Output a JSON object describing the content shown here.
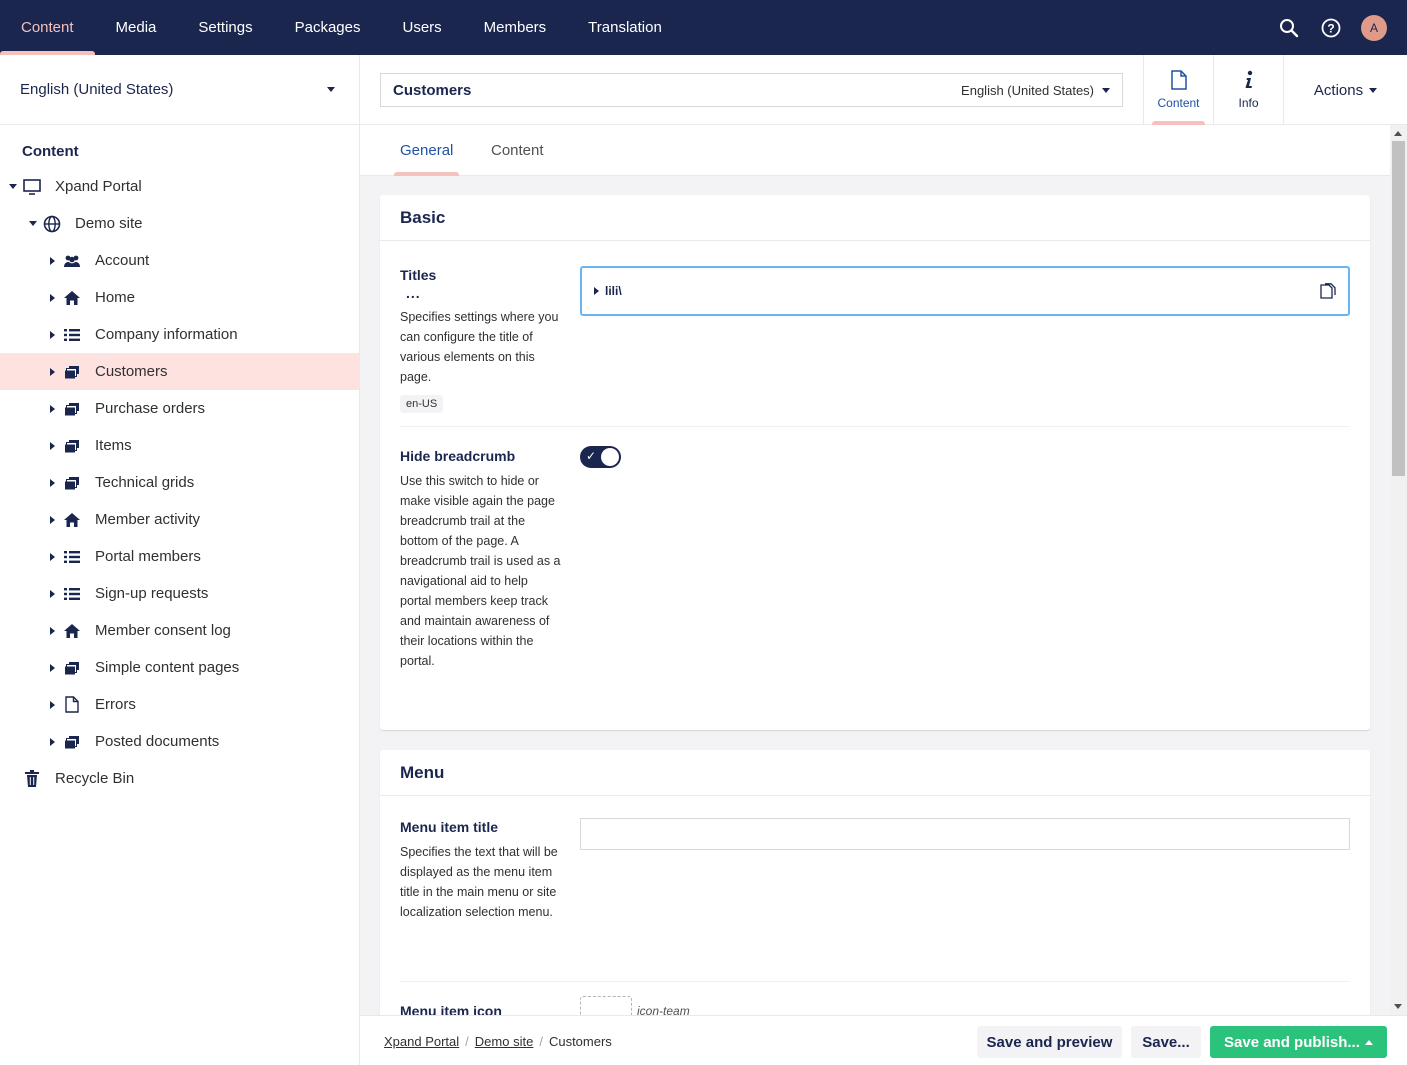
{
  "topnav": {
    "sections": [
      "Content",
      "Media",
      "Settings",
      "Packages",
      "Users",
      "Members",
      "Translation"
    ],
    "active_index": 0,
    "avatar_initial": "A",
    "icons": [
      "search-icon",
      "help-icon"
    ]
  },
  "tree": {
    "language": "English (United States)",
    "title": "Content",
    "root": "Xpand Portal",
    "site": "Demo site",
    "items": [
      {
        "label": "Account",
        "icon": "users-icon"
      },
      {
        "label": "Home",
        "icon": "home-icon"
      },
      {
        "label": "Company information",
        "icon": "list-icon"
      },
      {
        "label": "Customers",
        "icon": "documents-icon"
      },
      {
        "label": "Purchase orders",
        "icon": "documents-icon"
      },
      {
        "label": "Items",
        "icon": "documents-icon"
      },
      {
        "label": "Technical grids",
        "icon": "documents-icon"
      },
      {
        "label": "Member activity",
        "icon": "home-icon"
      },
      {
        "label": "Portal members",
        "icon": "list-icon"
      },
      {
        "label": "Sign-up requests",
        "icon": "list-icon"
      },
      {
        "label": "Member consent log",
        "icon": "home-icon"
      },
      {
        "label": "Simple content pages",
        "icon": "documents-icon"
      },
      {
        "label": "Errors",
        "icon": "document-icon"
      },
      {
        "label": "Posted documents",
        "icon": "documents-icon"
      }
    ],
    "selected_index": 3,
    "recycle_bin": "Recycle Bin"
  },
  "header": {
    "node_name": "Customers",
    "culture": "English (United States)",
    "apps": [
      "Content",
      "Info"
    ],
    "actions_label": "Actions"
  },
  "subtabs": [
    "General",
    "Content"
  ],
  "basic": {
    "title": "Basic",
    "titles_label": "Titles",
    "titles_dots": "...",
    "titles_desc": "Specifies settings where you can configure the title of various elements on this page.",
    "culture_tag": "en-US",
    "titles_value": "lili\\",
    "hide_label": "Hide breadcrumb",
    "hide_desc": "Use this switch to hide or make visible again the page breadcrumb trail at the bottom of the page. A breadcrumb trail is used as a navigational aid to help portal members keep track and maintain awareness of their locations within the portal.",
    "hide_value": true
  },
  "menu": {
    "title": "Menu",
    "item_title_label": "Menu item title",
    "item_title_desc": "Specifies the text that will be displayed as the menu item title in the main menu or site localization selection menu.",
    "item_title_value": "",
    "item_icon_label": "Menu item icon",
    "item_icon_value": "icon-team"
  },
  "footer": {
    "breadcrumb": [
      "Xpand Portal",
      "Demo site",
      "Customers"
    ],
    "save_preview": "Save and preview",
    "save": "Save...",
    "save_publish": "Save and publish..."
  },
  "colors": {
    "nav_bg": "#1b264f",
    "accent_pink": "#f5c1bc",
    "selected_bg": "#fde2e0",
    "publish_green": "#2bc37c",
    "focus_blue": "#6ab4f0"
  }
}
